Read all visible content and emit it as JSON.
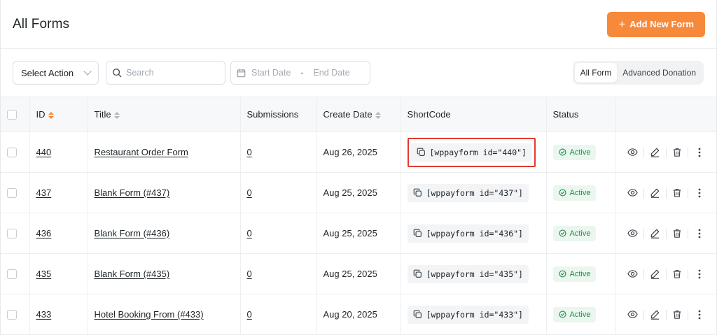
{
  "header": {
    "title": "All Forms",
    "add_button": "Add New Form"
  },
  "toolbar": {
    "select_action": "Select Action",
    "search_placeholder": "Search",
    "start_date": "Start Date",
    "date_separator": "-",
    "end_date": "End Date",
    "tabs": [
      {
        "label": "All Form",
        "active": true
      },
      {
        "label": "Advanced Donation",
        "active": false
      }
    ]
  },
  "table": {
    "columns": {
      "id": "ID",
      "title": "Title",
      "submissions": "Submissions",
      "create_date": "Create Date",
      "shortcode": "ShortCode",
      "status": "Status"
    },
    "rows": [
      {
        "id": "440",
        "title": "Restaurant Order Form",
        "submissions": "0",
        "date": "Aug 26, 2025",
        "shortcode": "[wppayform id=\"440\"]",
        "status": "Active",
        "highlight": true
      },
      {
        "id": "437",
        "title": "Blank Form (#437)",
        "submissions": "0",
        "date": "Aug 25, 2025",
        "shortcode": "[wppayform id=\"437\"]",
        "status": "Active",
        "highlight": false
      },
      {
        "id": "436",
        "title": "Blank Form (#436)",
        "submissions": "0",
        "date": "Aug 25, 2025",
        "shortcode": "[wppayform id=\"436\"]",
        "status": "Active",
        "highlight": false
      },
      {
        "id": "435",
        "title": "Blank Form (#435)",
        "submissions": "0",
        "date": "Aug 25, 2025",
        "shortcode": "[wppayform id=\"435\"]",
        "status": "Active",
        "highlight": false
      },
      {
        "id": "433",
        "title": "Hotel Booking From (#433)",
        "submissions": "0",
        "date": "Aug 20, 2025",
        "shortcode": "[wppayform id=\"433\"]",
        "status": "Active",
        "highlight": false
      }
    ]
  },
  "icons": {
    "add": "plus-icon",
    "search": "search-icon",
    "calendar": "calendar-icon",
    "copy": "copy-icon",
    "status": "check-circle-icon",
    "view": "eye-icon",
    "edit": "pencil-icon",
    "delete": "trash-icon",
    "more": "more-vertical-icon"
  },
  "colors": {
    "accent": "#f7893b",
    "active_badge_bg": "#eaf6ee",
    "active_badge_text": "#1f8a4c",
    "highlight_border": "#e23a2e"
  }
}
